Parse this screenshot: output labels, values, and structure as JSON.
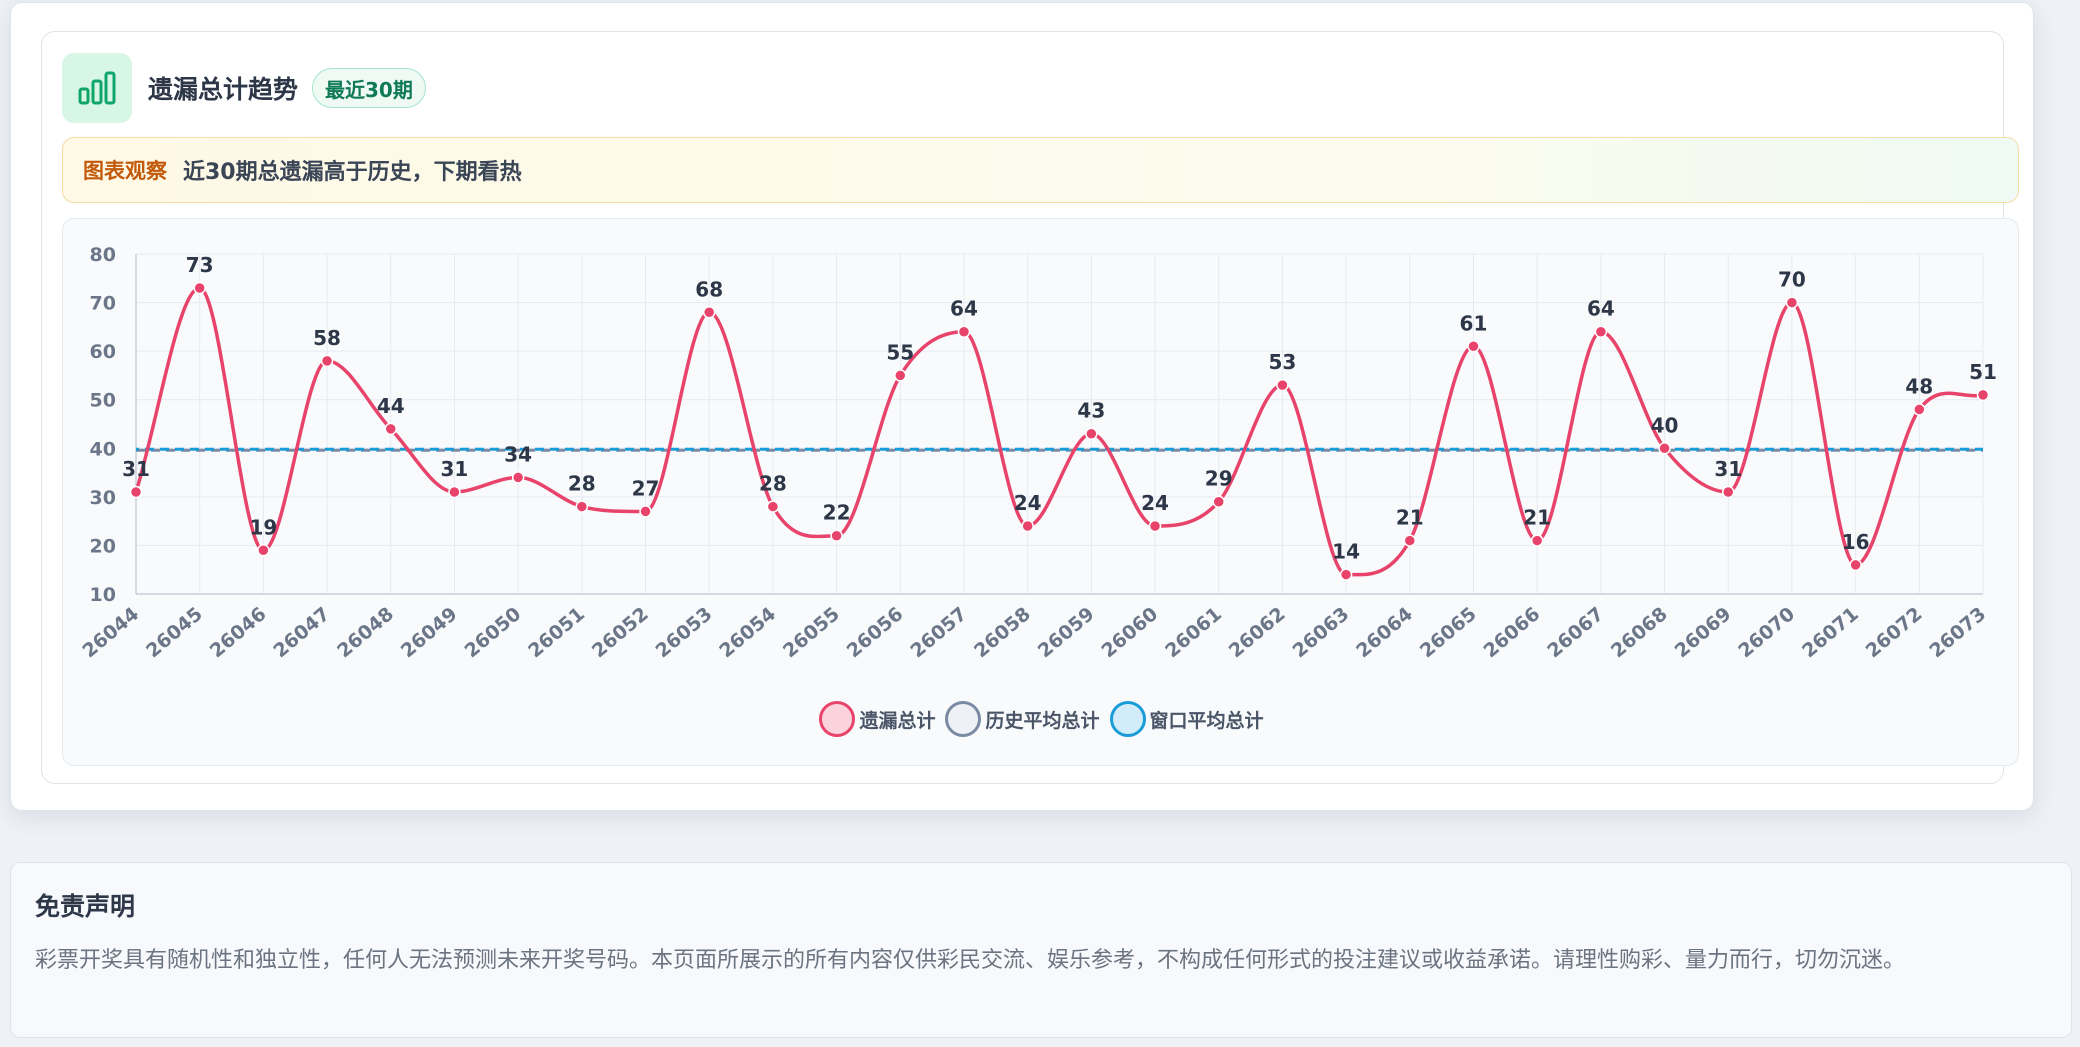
{
  "card": {
    "title": "遗漏总计趋势",
    "badge": "最近30期",
    "insight_label": "图表观察",
    "insight_text": "近30期总遗漏高于历史，下期看热"
  },
  "colors": {
    "series_main": "#e8436a",
    "series_history": "#7b8ba3",
    "series_window": "#1a9cd8",
    "badge_green": "#0f7a55",
    "icon_green": "#10a66a",
    "insight_orange": "#c25a0c"
  },
  "chart_data": {
    "type": "line",
    "x": [
      "26044",
      "26045",
      "26046",
      "26047",
      "26048",
      "26049",
      "26050",
      "26051",
      "26052",
      "26053",
      "26054",
      "26055",
      "26056",
      "26057",
      "26058",
      "26059",
      "26060",
      "26061",
      "26062",
      "26063",
      "26064",
      "26065",
      "26066",
      "26067",
      "26068",
      "26069",
      "26070",
      "26071",
      "26072",
      "26073"
    ],
    "ylim": [
      10,
      80
    ],
    "yticks": [
      10,
      20,
      30,
      40,
      50,
      60,
      70,
      80
    ],
    "grid": true,
    "legend_position": "bottom",
    "series": [
      {
        "name": "遗漏总计",
        "values": [
          31,
          73,
          19,
          58,
          44,
          31,
          34,
          28,
          27,
          68,
          28,
          22,
          55,
          64,
          24,
          43,
          24,
          29,
          53,
          14,
          21,
          61,
          21,
          64,
          40,
          31,
          70,
          16,
          48,
          51
        ],
        "style": "smooth-line-with-points"
      },
      {
        "name": "历史平均总计",
        "values": [
          39.6,
          39.6,
          39.6,
          39.6,
          39.6,
          39.6,
          39.6,
          39.6,
          39.6,
          39.6,
          39.6,
          39.6,
          39.6,
          39.6,
          39.6,
          39.6,
          39.6,
          39.6,
          39.6,
          39.6,
          39.6,
          39.6,
          39.6,
          39.6,
          39.6,
          39.6,
          39.6,
          39.6,
          39.6,
          39.6
        ],
        "style": "dashed"
      },
      {
        "name": "窗口平均总计",
        "values": [
          39.8,
          39.8,
          39.8,
          39.8,
          39.8,
          39.8,
          39.8,
          39.8,
          39.8,
          39.8,
          39.8,
          39.8,
          39.8,
          39.8,
          39.8,
          39.8,
          39.8,
          39.8,
          39.8,
          39.8,
          39.8,
          39.8,
          39.8,
          39.8,
          39.8,
          39.8,
          39.8,
          39.8,
          39.8,
          39.8
        ],
        "style": "dashed"
      }
    ]
  },
  "disclaimer": {
    "title": "免责声明",
    "text": "彩票开奖具有随机性和独立性，任何人无法预测未来开奖号码。本页面所展示的所有内容仅供彩民交流、娱乐参考，不构成任何形式的投注建议或收益承诺。请理性购彩、量力而行，切勿沉迷。"
  }
}
